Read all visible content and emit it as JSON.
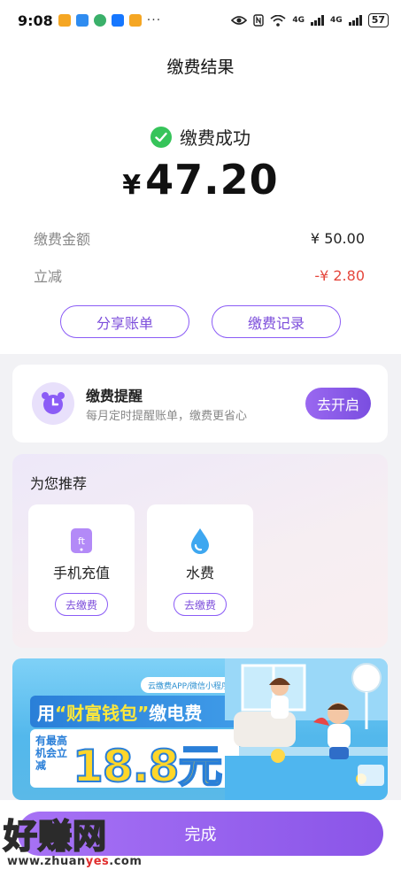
{
  "status_bar": {
    "time": "9:08",
    "more": "···",
    "network_1": "4G",
    "network_2": "4G",
    "battery": "57"
  },
  "header": {
    "title": "缴费结果"
  },
  "result": {
    "status": "缴费成功",
    "currency": "¥",
    "amount": "47.20",
    "rows": [
      {
        "label": "缴费金额",
        "value": "¥ 50.00"
      },
      {
        "label": "立减",
        "value": "-¥ 2.80"
      }
    ],
    "share_label": "分享账单",
    "records_label": "缴费记录"
  },
  "reminder": {
    "title": "缴费提醒",
    "subtitle": "每月定时提醒账单，缴费更省心",
    "button": "去开启"
  },
  "recommend": {
    "title": "为您推荐",
    "items": [
      {
        "name": "手机充值",
        "action": "去缴费",
        "icon": "phone-icon"
      },
      {
        "name": "水费",
        "action": "去缴费",
        "icon": "water-drop-icon"
      }
    ]
  },
  "banner": {
    "tag": "云缴费APP/微信小程序",
    "headline_prefix": "用",
    "headline_highlight": "“财富钱包”",
    "headline_suffix": "缴电费",
    "small_text": "有最高机会立减",
    "big_text": "18.8元"
  },
  "bottom": {
    "done_label": "完成"
  },
  "watermark": {
    "text": "好赚网",
    "url_prefix": "www.zhuan",
    "url_highlight": "yes",
    "url_suffix": ".com"
  },
  "colors": {
    "accent": "#8b5cf6",
    "success": "#36c45a",
    "discount": "#e5473d"
  }
}
